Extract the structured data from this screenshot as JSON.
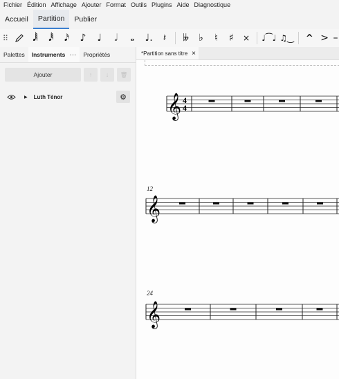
{
  "menu": [
    "Fichier",
    "Édition",
    "Affichage",
    "Ajouter",
    "Format",
    "Outils",
    "Plugins",
    "Aide",
    "Diagnostique"
  ],
  "workspace_tabs": [
    {
      "label": "Accueil",
      "active": false
    },
    {
      "label": "Partition",
      "active": true
    },
    {
      "label": "Publier",
      "active": false
    }
  ],
  "toolbar": {
    "handle_icon": "grip-icon",
    "pen_icon": "pencil-icon",
    "durations": [
      "64th-note-icon",
      "32nd-note-icon",
      "16th-note-icon",
      "eighth-note-icon",
      "quarter-note-icon",
      "half-note-icon",
      "whole-note-icon",
      "dot-icon",
      "rest-icon"
    ],
    "accidentals": [
      "double-flat-icon",
      "flat-icon",
      "natural-icon",
      "sharp-icon",
      "double-sharp-icon"
    ],
    "ties": [
      "tie-icon",
      "slur-icon"
    ],
    "articulations": [
      "marcato-icon",
      "accent-icon"
    ]
  },
  "panel": {
    "tabs": [
      {
        "label": "Palettes",
        "active": false
      },
      {
        "label": "Instruments",
        "active": true
      },
      {
        "label": "Propriétés",
        "active": false
      }
    ],
    "tab_menu": "···",
    "add_label": "Ajouter",
    "instrument": "Luth Ténor"
  },
  "document": {
    "tab_label": "*Partition sans titre",
    "close_label": "×"
  },
  "score": {
    "time_signature": {
      "numerator": "4",
      "denominator": "4"
    },
    "systems": [
      {
        "measure_number": ""
      },
      {
        "measure_number": "12"
      },
      {
        "measure_number": "24"
      }
    ]
  },
  "colors": {
    "accent": "#3b7fd0",
    "text": "#222222"
  }
}
